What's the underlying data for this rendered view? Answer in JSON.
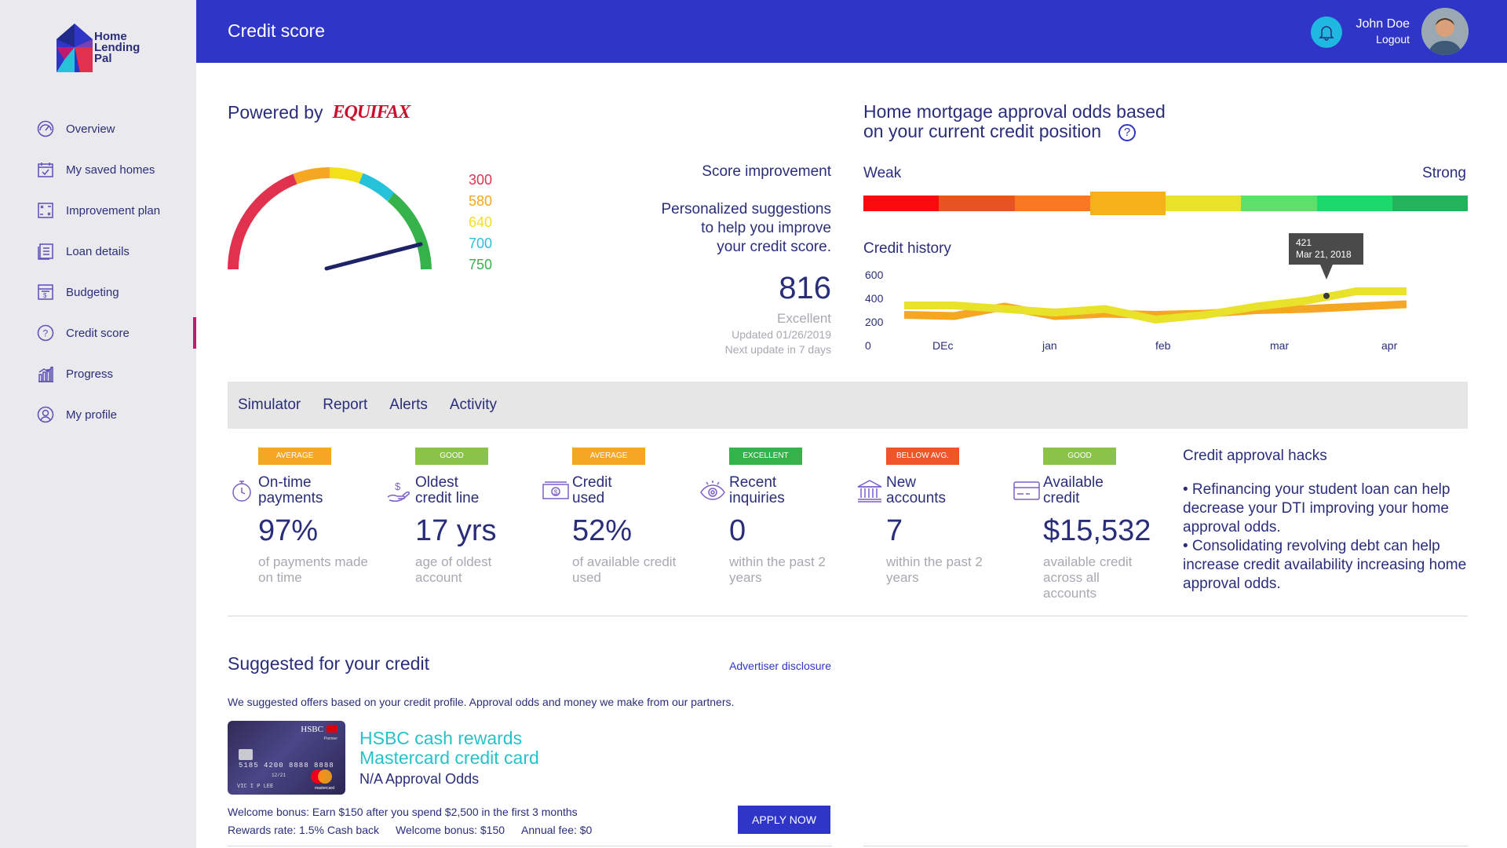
{
  "brand": {
    "name_line1": "Home",
    "name_line2": "Lending",
    "name_line3": "Pal"
  },
  "sidebar": {
    "items": [
      {
        "label": "Overview",
        "icon": "gauge-icon",
        "active": false
      },
      {
        "label": "My saved homes",
        "icon": "calendar-check-icon",
        "active": false
      },
      {
        "label": "Improvement plan",
        "icon": "plan-board-icon",
        "active": false
      },
      {
        "label": "Loan details",
        "icon": "document-list-icon",
        "active": false
      },
      {
        "label": "Budgeting",
        "icon": "budget-sheet-icon",
        "active": false
      },
      {
        "label": "Credit score",
        "icon": "question-circle-icon",
        "active": true
      },
      {
        "label": "Progress",
        "icon": "bar-chart-icon",
        "active": false
      },
      {
        "label": "My profile",
        "icon": "user-circle-icon",
        "active": false
      }
    ],
    "active_color": "#c0196e"
  },
  "header": {
    "title": "Credit score",
    "user_name": "John Doe",
    "logout_label": "Logout",
    "bg_color": "#2f35c7"
  },
  "powered": {
    "label": "Powered by",
    "brand": "EQUIFAX"
  },
  "gauge": {
    "legend": [
      {
        "value": "300",
        "color": "#e0324f"
      },
      {
        "value": "580",
        "color": "#f5a623"
      },
      {
        "value": "640",
        "color": "#f2e01b"
      },
      {
        "value": "700",
        "color": "#26c2d9"
      },
      {
        "value": "750",
        "color": "#36b24a"
      }
    ]
  },
  "score": {
    "improvement_label": "Score improvement",
    "suggestions_line1": "Personalized suggestions",
    "suggestions_line2": "to help you improve",
    "suggestions_line3": "your credit score.",
    "value": "816",
    "rating": "Excellent",
    "updated": "Updated 01/26/2019",
    "next_update": "Next update in 7 days"
  },
  "odds": {
    "title_line1": "Home mortgage approval odds based",
    "title_line2": "on your current credit position",
    "weak_label": "Weak",
    "strong_label": "Strong",
    "segments": [
      "#fb0b0b",
      "#e85322",
      "#f97821",
      "#f4b11a",
      "#e8e22a",
      "#5de06a",
      "#1dd86a",
      "#22b35c"
    ],
    "selected_index": 3
  },
  "credit_history": {
    "title": "Credit history",
    "tooltip_value": "421",
    "tooltip_date": "Mar 21, 2018"
  },
  "chart_data": {
    "type": "line",
    "x": [
      "DEc",
      "jan",
      "feb",
      "mar",
      "apr"
    ],
    "yticks": [
      "600",
      "400",
      "200",
      "0"
    ],
    "ylim": [
      0,
      600
    ],
    "series": [
      {
        "color": "#f5a623",
        "values": [
          260,
          250,
          330,
          250,
          270,
          260,
          270,
          300,
          310,
          330,
          350
        ]
      },
      {
        "color": "#e8e22a",
        "values": [
          340,
          340,
          310,
          280,
          310,
          220,
          260,
          330,
          380,
          460,
          460
        ]
      }
    ],
    "highlight": {
      "value": 421,
      "label": "Mar 21, 2018"
    }
  },
  "tabs": [
    "Simulator",
    "Report",
    "Alerts",
    "Activity"
  ],
  "metrics": [
    {
      "badge": "AVERAGE",
      "badge_color": "#f5a623",
      "icon": "stopwatch-icon",
      "label1": "On-time",
      "label2": "payments",
      "value": "97%",
      "desc": "of payments made on time"
    },
    {
      "badge": "GOOD",
      "badge_color": "#8bc34a",
      "icon": "hand-money-icon",
      "label1": "Oldest",
      "label2": "credit line",
      "value": "17 yrs",
      "desc": "age of oldest account"
    },
    {
      "badge": "AVERAGE",
      "badge_color": "#f5a623",
      "icon": "cash-icon",
      "label1": "Credit",
      "label2": "used",
      "value": "52%",
      "desc": "of available credit used"
    },
    {
      "badge": "EXCELLENT",
      "badge_color": "#36b24a",
      "icon": "eye-icon",
      "label1": "Recent",
      "label2": "inquiries",
      "value": "0",
      "desc": "within the past 2 years"
    },
    {
      "badge": "BELLOW AVG.",
      "badge_color": "#f0552a",
      "icon": "bank-icon",
      "label1": "New",
      "label2": "accounts",
      "value": "7",
      "desc": "within the past 2 years"
    },
    {
      "badge": "GOOD",
      "badge_color": "#8bc34a",
      "icon": "credit-card-icon",
      "label1": "Available",
      "label2": "credit",
      "value": "$15,532",
      "desc": "available credit across all accounts"
    }
  ],
  "hacks": {
    "title": "Credit approval hacks",
    "item1": "• Refinancing your student loan can help decrease your DTI improving your home approval odds.",
    "item2": "• Consolidating revolving debt can help increase credit availability increasing home approval odds."
  },
  "suggested": {
    "title": "Suggested for your credit",
    "disclosure": "Advertiser disclosure",
    "description": "We suggested offers based on your credit profile. Approval odds and money we make from our partners.",
    "card": {
      "bank": "HSBC",
      "tier": "Premier",
      "number": "5185 4200 8888 8888",
      "expiry": "12/21",
      "holder": "VIC I P LEE",
      "network": "mastercard",
      "title_line1": "HSBC cash rewards",
      "title_line2": "Mastercard credit card",
      "odds": "N/A Approval Odds",
      "welcome": "Welcome bonus: Earn $150 after you spend $2,500 in the first 3 months",
      "rewards_rate": "Rewards rate: 1.5% Cash back",
      "welcome_bonus": "Welcome bonus: $150",
      "annual_fee": "Annual fee: $0",
      "apply_label": "APPLY NOW"
    }
  }
}
